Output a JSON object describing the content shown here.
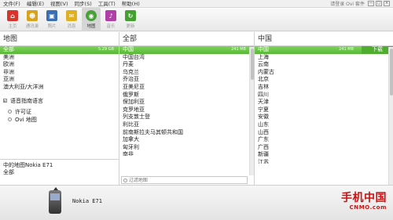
{
  "menubar": {
    "items": [
      "文件(F)",
      "编辑(E)",
      "视图(V)",
      "同步(S)",
      "工具(T)",
      "帮助(H)"
    ],
    "right_text": "请登录 Ovi 套件",
    "window_buttons": [
      "—",
      "□",
      "×"
    ]
  },
  "toolbar": {
    "buttons": [
      {
        "label": "主页",
        "icon": "home-icon",
        "color": "#d9342b"
      },
      {
        "label": "通讯录",
        "icon": "contacts-icon",
        "color": "#d9a21b"
      },
      {
        "label": "照片",
        "icon": "photos-icon",
        "color": "#3a6fb8"
      },
      {
        "label": "消息",
        "icon": "messages-icon",
        "color": "#e0b020"
      },
      {
        "label": "地图",
        "icon": "maps-icon",
        "color": "#4aa03a"
      },
      {
        "label": "音乐",
        "icon": "music-icon",
        "color": "#b23fa8"
      },
      {
        "label": "更新",
        "icon": "update-icon",
        "color": "#44a030"
      }
    ]
  },
  "left_panel": {
    "header": "地图",
    "items": [
      {
        "label": "全部",
        "size": "5.29 GB",
        "selected": true
      },
      {
        "label": "美洲"
      },
      {
        "label": "欧洲"
      },
      {
        "label": "非洲"
      },
      {
        "label": "亚洲"
      },
      {
        "label": "澳大利亚/大洋洲"
      }
    ],
    "options": {
      "voice_guidance": "语音指南语言",
      "license": "许可证",
      "ovi_maps": "Ovi 地图"
    }
  },
  "device_box": {
    "line1": "中的地图Nokia E71",
    "line2": "全部"
  },
  "mid_panel": {
    "header": "全部",
    "items": [
      {
        "label": "中国",
        "size": "241 MB",
        "selected": true
      },
      {
        "label": "中国台湾"
      },
      {
        "label": "丹麦"
      },
      {
        "label": "乌克兰"
      },
      {
        "label": "乔治亚"
      },
      {
        "label": "亚美尼亚"
      },
      {
        "label": "俄罗斯"
      },
      {
        "label": "保加利亚"
      },
      {
        "label": "克罗地亚"
      },
      {
        "label": "列支敦士登"
      },
      {
        "label": "利比亚"
      },
      {
        "label": "前南斯拉夫马其顿共和国"
      },
      {
        "label": "加拿大"
      },
      {
        "label": "匈牙利"
      },
      {
        "label": "南非"
      }
    ],
    "search_placeholder": "过滤地图"
  },
  "right_panel": {
    "header": "中国",
    "items": [
      {
        "label": "中国",
        "size": "241 MB",
        "selected": true,
        "action": "下载"
      },
      {
        "label": "上海"
      },
      {
        "label": "云南"
      },
      {
        "label": "内蒙古"
      },
      {
        "label": "北京"
      },
      {
        "label": "吉林"
      },
      {
        "label": "四川"
      },
      {
        "label": "天津"
      },
      {
        "label": "宁夏"
      },
      {
        "label": "安徽"
      },
      {
        "label": "山东"
      },
      {
        "label": "山西"
      },
      {
        "label": "广东"
      },
      {
        "label": "广西"
      },
      {
        "label": "新疆"
      },
      {
        "label": "江苏"
      }
    ]
  },
  "footer": {
    "device_name": "Nokia E71",
    "logo_cn": "手机中国",
    "logo_en": "CNMO.com"
  },
  "colors": {
    "selection": "#58b838",
    "brand_red": "#cc1111"
  }
}
